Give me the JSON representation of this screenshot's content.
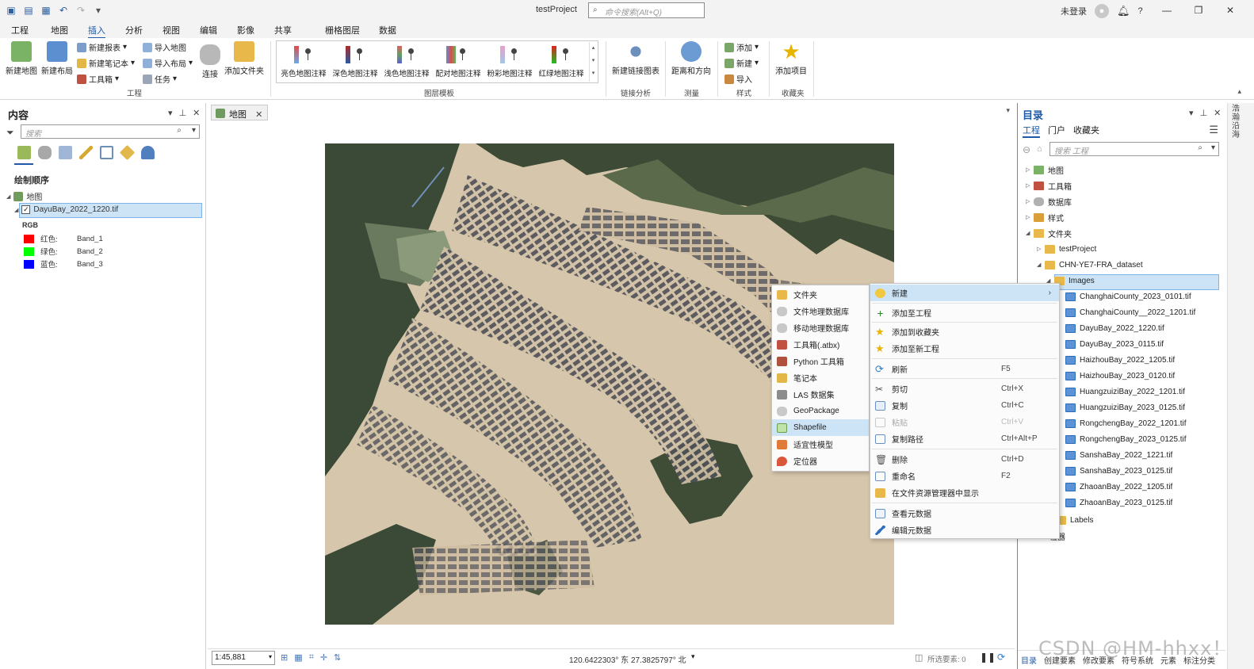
{
  "titlebar": {
    "project_title": "testProject",
    "command_search_placeholder": "命令搜索(Alt+Q)",
    "user_label": "未登录",
    "help": "?"
  },
  "ribbon_tabs": [
    "工程",
    "地图",
    "插入",
    "分析",
    "视图",
    "编辑",
    "影像",
    "共享",
    "栅格图层",
    "数据"
  ],
  "ribbon": {
    "new_map": "新建地图",
    "new_layout": "新建布局",
    "new_report": "新建报表",
    "new_notebook": "新建笔记本",
    "toolbox": "工具箱",
    "import_map": "导入地图",
    "import_layout": "导入布局",
    "task": "任务",
    "connect": "连接",
    "add_folder": "添加文件夹",
    "group_project": "工程",
    "gallery": [
      "亮色地图注释",
      "深色地图注释",
      "浅色地图注释",
      "配对地图注释",
      "粉彩地图注释",
      "红绿地图注释"
    ],
    "group_layer_templates": "图层模板",
    "new_link_chart": "新建链接图表",
    "group_link_analysis": "链接分析",
    "distance_direction": "距离和方向",
    "group_measure": "测量",
    "style_add": "添加",
    "style_new": "新建",
    "style_import": "导入",
    "group_styles": "样式",
    "add_item": "添加项目",
    "group_favorites": "收藏夹"
  },
  "contents": {
    "title": "内容",
    "search_placeholder": "搜索",
    "drawing_order": "绘制顺序",
    "map_name": "地图",
    "layer_name": "DayuBay_2022_1220.tif",
    "renderer": "RGB",
    "bands": [
      {
        "label": "红色:",
        "band": "Band_1",
        "color": "#ff0000"
      },
      {
        "label": "绿色:",
        "band": "Band_2",
        "color": "#00ff00"
      },
      {
        "label": "蓝色:",
        "band": "Band_3",
        "color": "#0000ff"
      }
    ]
  },
  "map_view": {
    "tab_label": "地图",
    "scale": "1:45,881",
    "coordinates": "120.6422303° 东 27.3825797° 北",
    "selected_features": "所选要素: 0"
  },
  "catalog": {
    "title": "目录",
    "tabs": [
      "工程",
      "门户",
      "收藏夹"
    ],
    "search_placeholder": "搜索 工程",
    "tree": [
      {
        "label": "地图",
        "level": 0
      },
      {
        "label": "工具箱",
        "level": 0
      },
      {
        "label": "数据库",
        "level": 0
      },
      {
        "label": "样式",
        "level": 0
      },
      {
        "label": "文件夹",
        "level": 0
      },
      {
        "label": "testProject",
        "level": 1
      },
      {
        "label": "CHN-YE7-FRA_dataset",
        "level": 1
      },
      {
        "label": "Images",
        "level": 2
      },
      {
        "label": "ChanghaiCounty_2023_0101.tif",
        "level": 3
      },
      {
        "label": "ChanghaiCounty__2022_1201.tif",
        "level": 3
      },
      {
        "label": "DayuBay_2022_1220.tif",
        "level": 3
      },
      {
        "label": "DayuBay_2023_0115.tif",
        "level": 3
      },
      {
        "label": "HaizhouBay_2022_1205.tif",
        "level": 3
      },
      {
        "label": "HaizhouBay_2023_0120.tif",
        "level": 3
      },
      {
        "label": "HuangzuiziBay_2022_1201.tif",
        "level": 3
      },
      {
        "label": "HuangzuiziBay_2023_0125.tif",
        "level": 3
      },
      {
        "label": "RongchengBay_2022_1201.tif",
        "level": 3
      },
      {
        "label": "RongchengBay_2023_0125.tif",
        "level": 3
      },
      {
        "label": "SanshaBay_2022_1221.tif",
        "level": 3
      },
      {
        "label": "SanshaBay_2023_0125.tif",
        "level": 3
      },
      {
        "label": "ZhaoanBay_2022_1205.tif",
        "level": 3
      },
      {
        "label": "ZhaoanBay_2023_0125.tif",
        "level": 3
      },
      {
        "label": "Labels",
        "level": 2
      },
      {
        "label": "位器",
        "level": 1
      }
    ],
    "bottom_tabs": [
      "目录",
      "创建要素",
      "修改要素",
      "符号系统",
      "元素",
      "标注分类"
    ]
  },
  "side_strip": "浩瀚沿海",
  "context_menu": {
    "items": [
      {
        "label": "新建",
        "key": "",
        "submenu": true
      },
      {
        "label": "添加至工程",
        "key": ""
      },
      {
        "label": "添加到收藏夹",
        "key": ""
      },
      {
        "label": "添加至新工程",
        "key": ""
      },
      {
        "label": "刷新",
        "key": "F5"
      },
      {
        "label": "剪切",
        "key": "Ctrl+X"
      },
      {
        "label": "复制",
        "key": "Ctrl+C"
      },
      {
        "label": "粘贴",
        "key": "Ctrl+V",
        "disabled": true
      },
      {
        "label": "复制路径",
        "key": "Ctrl+Alt+P"
      },
      {
        "label": "删除",
        "key": "Ctrl+D"
      },
      {
        "label": "重命名",
        "key": "F2"
      },
      {
        "label": "在文件资源管理器中显示",
        "key": ""
      },
      {
        "label": "查看元数据",
        "key": ""
      },
      {
        "label": "编辑元数据",
        "key": ""
      }
    ]
  },
  "new_submenu": {
    "items": [
      "文件夹",
      "文件地理数据库",
      "移动地理数据库",
      "工具箱(.atbx)",
      "Python 工具箱",
      "笔记本",
      "LAS 数据集",
      "GeoPackage",
      "Shapefile",
      "适宜性模型",
      "定位器"
    ]
  },
  "watermark": "CSDN @HM-hhxx！",
  "colors": {
    "accent": "#1e5aa8",
    "selection": "#cde4f7"
  }
}
